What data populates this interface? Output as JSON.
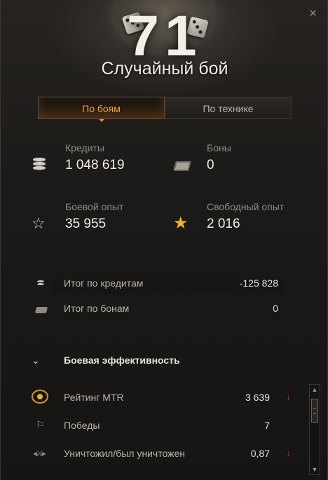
{
  "header": {
    "battle_number": "71",
    "battle_type": "Случайный бой",
    "close_glyph": "✕"
  },
  "tabs": [
    {
      "label": "По боям",
      "active": true
    },
    {
      "label": "По технике",
      "active": false
    }
  ],
  "stats": {
    "credits": {
      "label": "Кредиты",
      "value": "1 048 619",
      "icon": "coins-icon"
    },
    "bonds": {
      "label": "Боны",
      "value": "0",
      "icon": "bond-icon"
    },
    "battle_xp": {
      "label": "Боевой опыт",
      "value": "35 955",
      "icon": "star-outline-icon"
    },
    "free_xp": {
      "label": "Свободный опыт",
      "value": "2 016",
      "icon": "star-gold-icon"
    }
  },
  "summary": {
    "credits_total": {
      "label": "Итог по кредитам",
      "value": "-125 828"
    },
    "bonds_total": {
      "label": "Итог по бонам",
      "value": "0"
    }
  },
  "efficiency": {
    "title": "Боевая эффективность",
    "rows": [
      {
        "label": "Рейтинг MTR",
        "value": "3 639",
        "trend": "down",
        "icon": "laurel-icon"
      },
      {
        "label": "Победы",
        "value": "7",
        "trend": "none",
        "icon": "flag-icon"
      },
      {
        "label": "Уничтожил/был уничтожен",
        "value": "0,87",
        "trend": "down",
        "icon": "vs-icon"
      }
    ]
  },
  "colors": {
    "accent": "#f0a040",
    "trend_down": "#d02a1e",
    "free_xp_star": "#f0b42c"
  }
}
